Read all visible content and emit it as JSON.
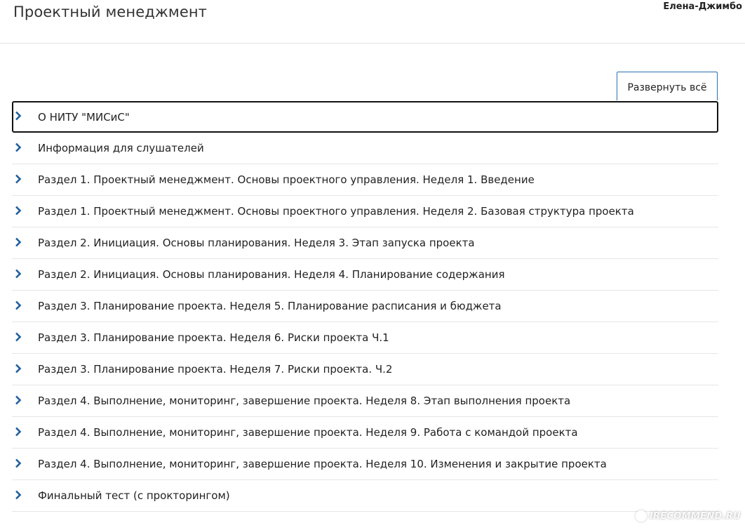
{
  "header": {
    "course_title": "Проектный менеджмент",
    "user_name": "Елена-Джимбо"
  },
  "toolbar": {
    "expand_all_label": "Развернуть всё"
  },
  "colors": {
    "chevron": "#1f5f9e",
    "button_border": "#2a6fb0",
    "divider": "#e6e6e6"
  },
  "sections": [
    {
      "label": "О НИТУ \"МИСиС\"",
      "icon": "chevron-right-icon",
      "focused": true
    },
    {
      "label": "Информация для слушателей",
      "icon": "chevron-right-icon"
    },
    {
      "label": "Раздел 1. Проектный менеджмент. Основы проектного управления. Неделя 1. Введение",
      "icon": "chevron-right-icon"
    },
    {
      "label": "Раздел 1. Проектный менеджмент. Основы проектного управления. Неделя 2. Базовая структура проекта",
      "icon": "chevron-right-icon"
    },
    {
      "label": "Раздел 2. Инициация. Основы планирования. Неделя 3. Этап запуска проекта",
      "icon": "chevron-right-icon"
    },
    {
      "label": "Раздел 2. Инициация. Основы планирования. Неделя 4. Планирование содержания",
      "icon": "chevron-right-icon"
    },
    {
      "label": "Раздел 3. Планирование проекта. Неделя 5. Планирование расписания и бюджета",
      "icon": "chevron-right-icon"
    },
    {
      "label": "Раздел 3. Планирование проекта. Неделя 6. Риски проекта Ч.1",
      "icon": "chevron-right-icon"
    },
    {
      "label": "Раздел 3. Планирование проекта. Неделя 7. Риски проекта. Ч.2",
      "icon": "chevron-right-icon"
    },
    {
      "label": "Раздел 4. Выполнение, мониторинг, завершение проекта. Неделя 8. Этап выполнения проекта",
      "icon": "chevron-right-icon"
    },
    {
      "label": "Раздел 4. Выполнение, мониторинг, завершение проекта. Неделя 9. Работа с командой проекта",
      "icon": "chevron-right-icon"
    },
    {
      "label": "Раздел 4. Выполнение, мониторинг, завершение проекта. Неделя 10. Изменения и закрытие проекта",
      "icon": "chevron-right-icon"
    },
    {
      "label": "Финальный тест (с прокторингом)",
      "icon": "chevron-right-icon"
    }
  ],
  "watermark": {
    "text": "IRECOMMEND.RU"
  }
}
